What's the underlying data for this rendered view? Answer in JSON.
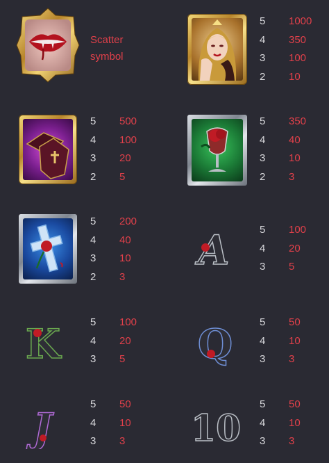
{
  "scatter": {
    "label": "Scatter symbol"
  },
  "symbols": [
    {
      "name": "vampire-lady",
      "pays": [
        {
          "count": "5",
          "amount": "1000"
        },
        {
          "count": "4",
          "amount": "350"
        },
        {
          "count": "3",
          "amount": "100"
        },
        {
          "count": "2",
          "amount": "10"
        }
      ]
    },
    {
      "name": "coffin",
      "pays": [
        {
          "count": "5",
          "amount": "500"
        },
        {
          "count": "4",
          "amount": "100"
        },
        {
          "count": "3",
          "amount": "20"
        },
        {
          "count": "2",
          "amount": "5"
        }
      ]
    },
    {
      "name": "rose-goblet",
      "pays": [
        {
          "count": "5",
          "amount": "350"
        },
        {
          "count": "4",
          "amount": "40"
        },
        {
          "count": "3",
          "amount": "10"
        },
        {
          "count": "2",
          "amount": "3"
        }
      ]
    },
    {
      "name": "cross-rose",
      "pays": [
        {
          "count": "5",
          "amount": "200"
        },
        {
          "count": "4",
          "amount": "40"
        },
        {
          "count": "3",
          "amount": "10"
        },
        {
          "count": "2",
          "amount": "3"
        }
      ]
    },
    {
      "name": "letter-a",
      "glyph": "A",
      "pays": [
        {
          "count": "5",
          "amount": "100"
        },
        {
          "count": "4",
          "amount": "20"
        },
        {
          "count": "3",
          "amount": "5"
        }
      ]
    },
    {
      "name": "letter-k",
      "glyph": "K",
      "pays": [
        {
          "count": "5",
          "amount": "100"
        },
        {
          "count": "4",
          "amount": "20"
        },
        {
          "count": "3",
          "amount": "5"
        }
      ]
    },
    {
      "name": "letter-q",
      "glyph": "Q",
      "pays": [
        {
          "count": "5",
          "amount": "50"
        },
        {
          "count": "4",
          "amount": "10"
        },
        {
          "count": "3",
          "amount": "3"
        }
      ]
    },
    {
      "name": "letter-j",
      "glyph": "J",
      "pays": [
        {
          "count": "5",
          "amount": "50"
        },
        {
          "count": "4",
          "amount": "10"
        },
        {
          "count": "3",
          "amount": "3"
        }
      ]
    },
    {
      "name": "number-10",
      "glyph": "10",
      "pays": [
        {
          "count": "5",
          "amount": "50"
        },
        {
          "count": "4",
          "amount": "10"
        },
        {
          "count": "3",
          "amount": "3"
        }
      ]
    }
  ],
  "colors": {
    "background": "#2a2a33",
    "count_text": "#d8d8dc",
    "payout_text": "#e0404a"
  }
}
